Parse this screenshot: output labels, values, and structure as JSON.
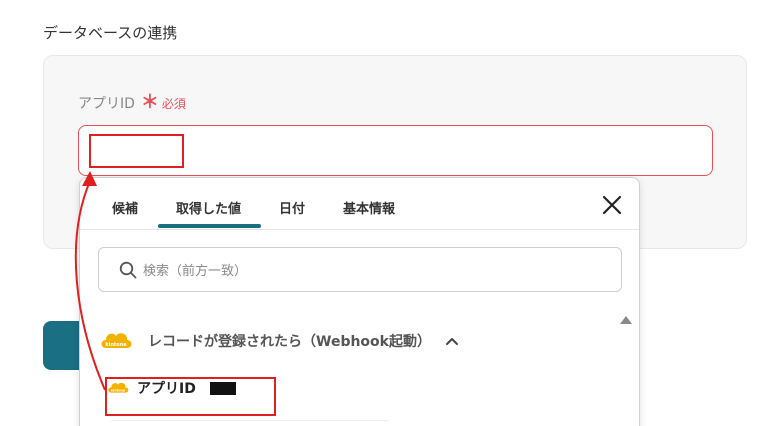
{
  "section": {
    "title": "データベースの連携"
  },
  "field": {
    "label": "アプリID",
    "required_mark": "＊",
    "required_text": "必須",
    "value": ""
  },
  "popup": {
    "tabs": [
      {
        "label": "候補"
      },
      {
        "label": "取得した値"
      },
      {
        "label": "日付"
      },
      {
        "label": "基本情報"
      }
    ],
    "active_tab": 1,
    "search_placeholder": "検索（前方一致）",
    "group": {
      "label": "レコードが登録されたら（Webhook起動）",
      "logo_text": "kintone"
    },
    "item": {
      "label": "アプリID",
      "logo_text": "kintone"
    }
  },
  "colors": {
    "accent": "#1a6f83",
    "required": "#e8505b",
    "highlight": "#e02020"
  }
}
